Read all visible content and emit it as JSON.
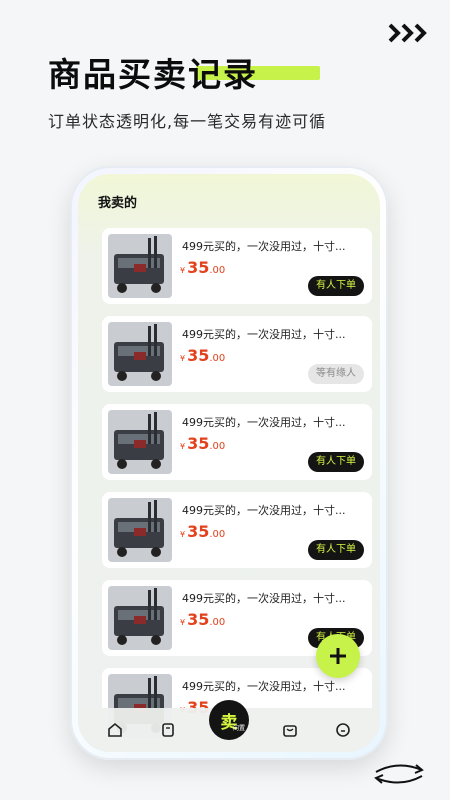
{
  "header": {
    "title": "商品买卖记录",
    "subtitle": "订单状态透明化,每一笔交易有迹可循"
  },
  "colors": {
    "accent": "#c6f24a",
    "price": "#e3421c",
    "dark": "#141414"
  },
  "screen": {
    "section_title": "我卖的",
    "items": [
      {
        "desc": "499元买的，一次没用过，十寸...",
        "currency": "¥",
        "price_int": "35",
        "price_dec": ".00",
        "tag": "有人下单",
        "tag_style": "dark"
      },
      {
        "desc": "499元买的，一次没用过，十寸...",
        "currency": "¥",
        "price_int": "35",
        "price_dec": ".00",
        "tag": "等有缘人",
        "tag_style": "light"
      },
      {
        "desc": "499元买的，一次没用过，十寸...",
        "currency": "¥",
        "price_int": "35",
        "price_dec": ".00",
        "tag": "有人下单",
        "tag_style": "dark"
      },
      {
        "desc": "499元买的，一次没用过，十寸...",
        "currency": "¥",
        "price_int": "35",
        "price_dec": ".00",
        "tag": "有人下单",
        "tag_style": "dark"
      },
      {
        "desc": "499元买的，一次没用过，十寸...",
        "currency": "¥",
        "price_int": "35",
        "price_dec": ".00",
        "tag": "有人下单",
        "tag_style": "dark"
      },
      {
        "desc": "499元买的，一次没用过，十寸...",
        "currency": "¥",
        "price_int": "35",
        "price_dec": ".00",
        "tag": "",
        "tag_style": "dark"
      }
    ],
    "fab_icon": "plus-icon",
    "tabbar": {
      "tabs": [
        "home-icon",
        "note-icon",
        "sell",
        "bag-icon",
        "chat-icon"
      ],
      "sell_label": "卖",
      "sell_small": "闲置"
    }
  },
  "decor": {
    "top_icon": "triple-chevron-icon",
    "bottom_icon": "swap-arrows-icon"
  }
}
